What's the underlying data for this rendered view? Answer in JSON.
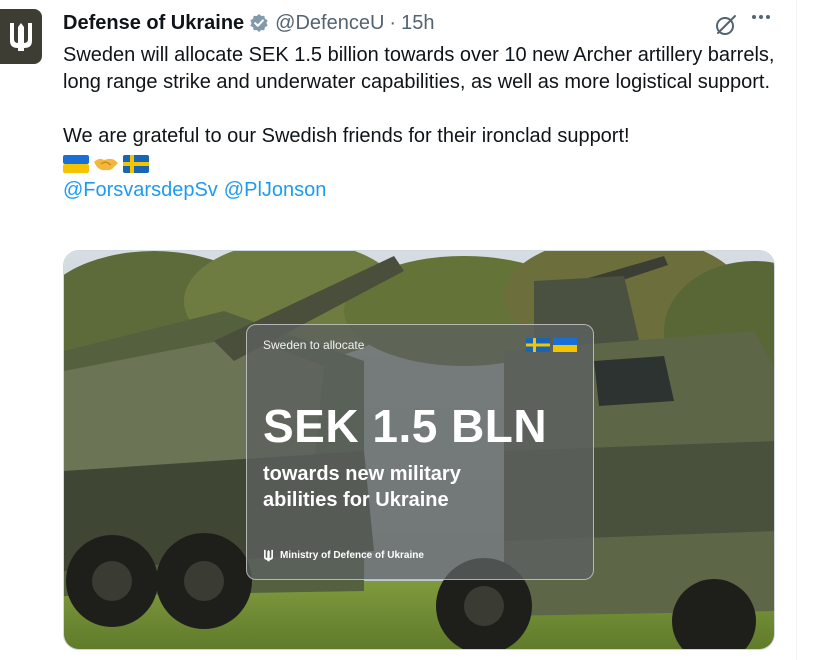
{
  "tweet": {
    "author_name": "Defense of Ukraine",
    "handle": "@DefenceU",
    "separator": "·",
    "time": "15h",
    "paragraph1": "Sweden will allocate SEK 1.5 billion towards over 10 new Archer artillery barrels, long range strike and underwater capabilities, as well as more logistical support.",
    "paragraph2": "We are grateful to our Swedish friends for their ironclad support!",
    "emojis": [
      "ukraine-flag",
      "handshake",
      "sweden-flag"
    ],
    "mentions": [
      "@ForsvarsdepSv",
      "@PlJonson"
    ]
  },
  "media_card": {
    "top_label": "Sweden to allocate",
    "amount": "SEK 1.5 BLN",
    "subtitle_line1": "towards new military",
    "subtitle_line2": "abilities for Ukraine",
    "footer": "Ministry of Defence of Ukraine"
  },
  "icons": {
    "verified": "verified-badge-icon",
    "grok": "grok-icon",
    "more": "more-icon"
  },
  "colors": {
    "text": "#0f1419",
    "secondary": "#536471",
    "link": "#1d9bf0",
    "avatar_bg": "#3d3d33"
  }
}
